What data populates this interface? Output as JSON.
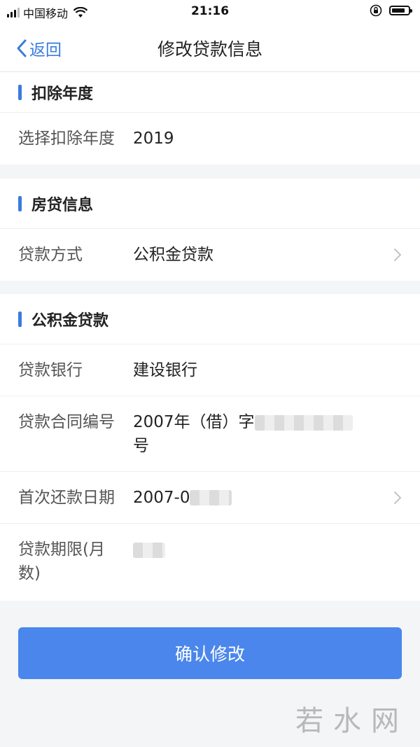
{
  "status_bar": {
    "carrier": "中国移动",
    "time": "21:16",
    "battery_level": 0.8
  },
  "nav": {
    "back_label": "返回",
    "title": "修改贷款信息"
  },
  "sections": {
    "deduction_year": {
      "title": "扣除年度",
      "row_label": "选择扣除年度",
      "row_value": "2019"
    },
    "mortgage_info": {
      "title": "房贷信息",
      "row_label": "贷款方式",
      "row_value": "公积金贷款"
    },
    "provident_loan": {
      "title": "公积金贷款",
      "bank_label": "贷款银行",
      "bank_value": "建设银行",
      "contract_label": "贷款合同编号",
      "contract_value_prefix": "2007年（借）字",
      "contract_value_suffix": "号",
      "first_repay_label": "首次还款日期",
      "first_repay_value_prefix": "2007-0",
      "term_label": "贷款期限(月数)"
    }
  },
  "confirm_button": "确认修改",
  "watermark": "若水网"
}
